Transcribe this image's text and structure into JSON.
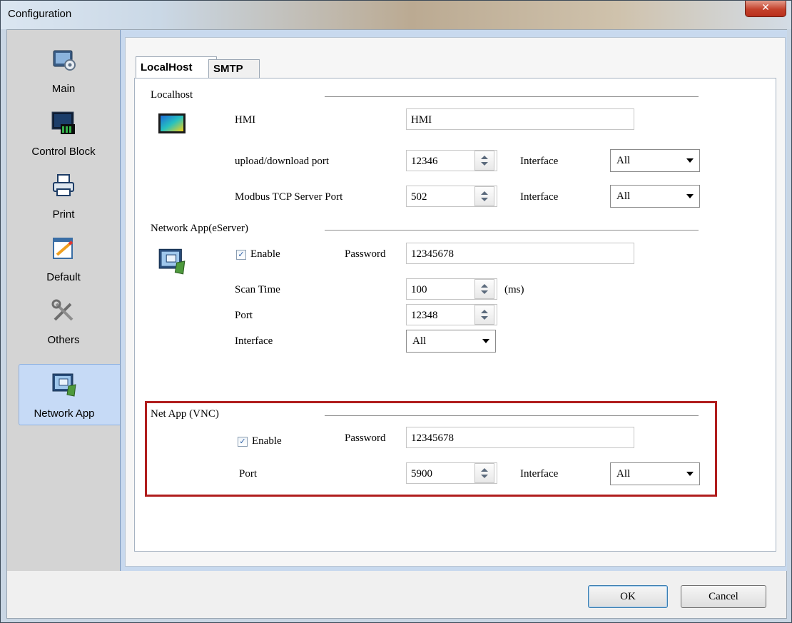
{
  "window": {
    "title": "Configuration",
    "close_icon": "close-icon"
  },
  "sidebar": {
    "items": [
      {
        "label": "Main",
        "icon": "main-monitor-icon"
      },
      {
        "label": "Control Block",
        "icon": "control-block-icon"
      },
      {
        "label": "Print",
        "icon": "printer-icon"
      },
      {
        "label": "Default",
        "icon": "default-edit-icon"
      },
      {
        "label": "Others",
        "icon": "tools-icon"
      },
      {
        "label": "Network App",
        "icon": "network-app-icon",
        "active": true
      }
    ]
  },
  "tabs": [
    {
      "label": "LocalHost",
      "active": true
    },
    {
      "label": "SMTP",
      "active": false
    }
  ],
  "localhost": {
    "section_title": "Localhost",
    "hmi_label": "HMI",
    "hmi_value": "HMI",
    "upload_port_label": "upload/download port",
    "upload_port_value": "12346",
    "upload_interface_label": "Interface",
    "upload_interface_value": "All",
    "modbus_label": "Modbus TCP  Server Port",
    "modbus_value": "502",
    "modbus_interface_label": "Interface",
    "modbus_interface_value": "All"
  },
  "eserver": {
    "section_title": "Network App(eServer)",
    "enable_label": "Enable",
    "enabled": true,
    "password_label": "Password",
    "password_value": "12345678",
    "scan_time_label": "Scan Time",
    "scan_time_value": "100",
    "scan_time_unit": "(ms)",
    "port_label": "Port",
    "port_value": "12348",
    "interface_label": "Interface",
    "interface_value": "All"
  },
  "vnc": {
    "section_title": "Net App (VNC)",
    "enable_label": "Enable",
    "enabled": true,
    "password_label": "Password",
    "password_value": "12345678",
    "port_label": "Port",
    "port_value": "5900",
    "interface_label": "Interface",
    "interface_value": "All",
    "highlight_color": "#b01d1d"
  },
  "footer": {
    "ok_label": "OK",
    "cancel_label": "Cancel"
  }
}
